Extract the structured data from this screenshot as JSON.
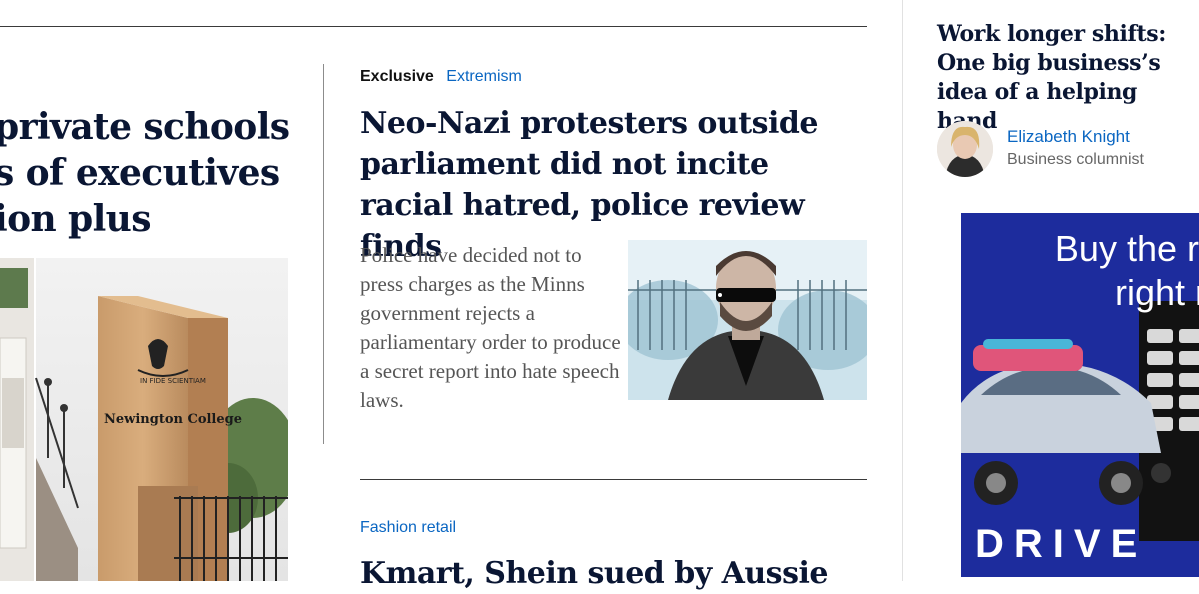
{
  "left_story": {
    "headline_lines": [
      "private schools",
      "s of executives",
      "ion plus"
    ],
    "image_caption": "Newington College",
    "image_motto": "IN FIDE SCIENTIAM"
  },
  "main_story": {
    "kicker_exclusive": "Exclusive",
    "kicker_topic": "Extremism",
    "headline": "Neo-Nazi protesters outside parliament did not incite racial hatred, police review finds",
    "summary": "Police have decided not to press charges as the Minns government rejects a parliamentary order to produce a secret report into hate speech laws."
  },
  "second_story": {
    "kicker": "Fashion retail",
    "headline": "Kmart, Shein sued by Aussie"
  },
  "right_column": {
    "headline": "Work longer shifts: One big business’s idea of a helping hand",
    "author_name": "Elizabeth Knight",
    "author_role": "Business columnist"
  },
  "ad": {
    "line1": "Buy the ri",
    "line2": "right r",
    "brand": "DRIVE"
  },
  "colors": {
    "headline": "#0a1633",
    "link": "#0a66c2",
    "ad_background": "#1d2c9d"
  }
}
